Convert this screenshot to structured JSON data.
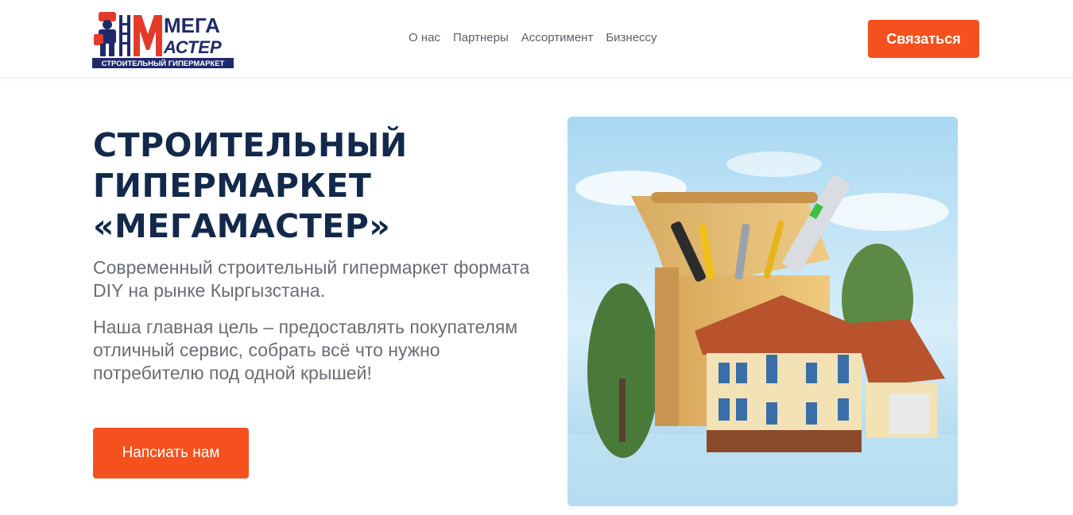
{
  "header": {
    "logo": {
      "line1": "МЕГА",
      "line2": "АСТЕР",
      "tagline": "СТРОИТЕЛЬНЫЙ ГИПЕРМАРКЕТ",
      "mascot_icon": "builder-mascot-icon"
    },
    "nav": [
      {
        "label": "О нас"
      },
      {
        "label": "Партнеры"
      },
      {
        "label": "Ассортимент"
      },
      {
        "label": "Бизнессу"
      }
    ],
    "contact_button": "Связаться"
  },
  "hero": {
    "title_lines": [
      "СТРОИТЕЛЬНЫЙ",
      "ГИПЕРМАРКЕТ",
      "«МЕГАМАСТЕР»"
    ],
    "subtitle": "Современный строительный гипермаркет формата DIY на рынке Кыргызстана.",
    "goal": "Наша главная цель – предоставлять покупателям отличный сервис, собрать всё что нужно потребителю под одной крышей!",
    "button": "Напсиать нам",
    "image": "toolbox-with-house-illustration"
  },
  "colors": {
    "accent": "#f5511e",
    "title": "#13294b",
    "text": "#6a6d73",
    "logo_blue": "#1f2a6b",
    "logo_red": "#e53a2a"
  }
}
